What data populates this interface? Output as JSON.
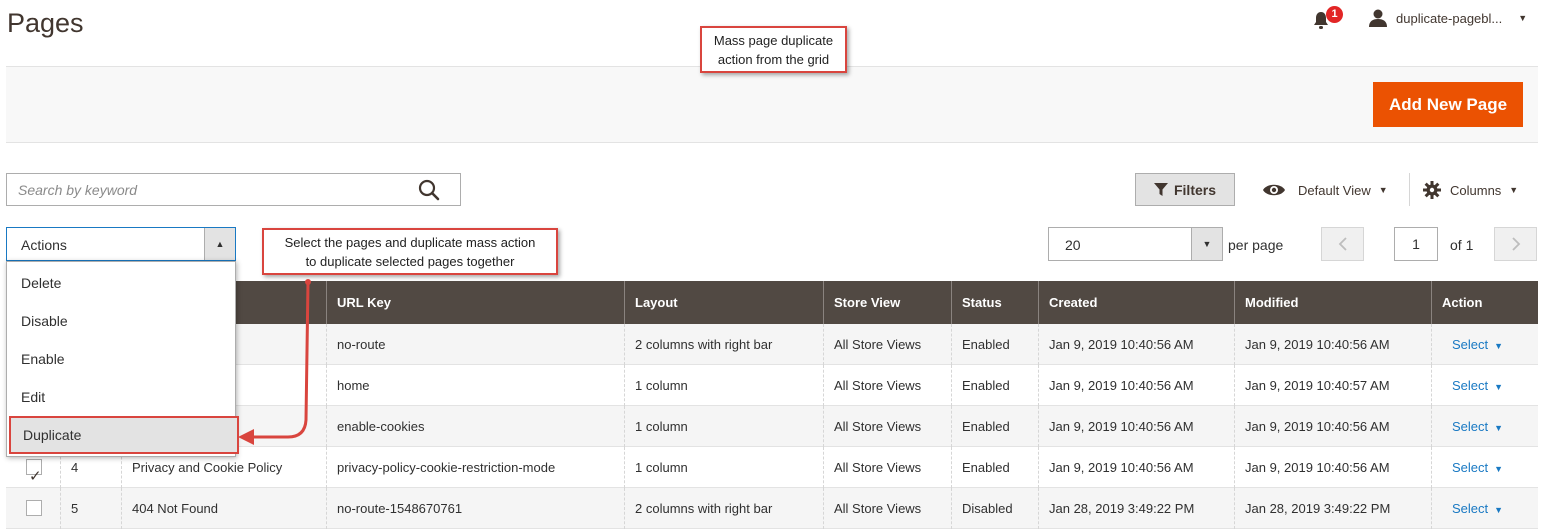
{
  "header": {
    "title": "Pages",
    "notification_count": "1",
    "user_name": "duplicate-pagebl..."
  },
  "annotations": {
    "top": "Mass page duplicate action from the grid",
    "top_line1": "Mass page duplicate",
    "top_line2": "action from the grid",
    "mid_line1": "Select the pages and duplicate mass action",
    "mid_line2": "to duplicate selected pages together"
  },
  "toolbar": {
    "add_new_page": "Add New Page",
    "search_placeholder": "Search by keyword",
    "filters": "Filters",
    "default_view": "Default View",
    "columns": "Columns"
  },
  "actions": {
    "label": "Actions",
    "items": [
      "Delete",
      "Disable",
      "Enable",
      "Edit",
      "Duplicate"
    ]
  },
  "pagination": {
    "per_page_value": "20",
    "per_page_label": "per page",
    "current_page": "1",
    "total": "of 1"
  },
  "grid": {
    "columns": [
      "URL Key",
      "Layout",
      "Store View",
      "Status",
      "Created",
      "Modified",
      "Action"
    ],
    "rows": [
      {
        "checked": false,
        "id": "",
        "title": "",
        "url_key": "no-route",
        "layout": "2 columns with right bar",
        "store_view": "All Store Views",
        "status": "Enabled",
        "created": "Jan 9, 2019 10:40:56 AM",
        "modified": "Jan 9, 2019 10:40:56 AM",
        "action": "Select"
      },
      {
        "checked": false,
        "id": "",
        "title": "",
        "url_key": "home",
        "layout": "1 column",
        "store_view": "All Store Views",
        "status": "Enabled",
        "created": "Jan 9, 2019 10:40:56 AM",
        "modified": "Jan 9, 2019 10:40:57 AM",
        "action": "Select"
      },
      {
        "checked": false,
        "id": "",
        "title": "",
        "url_key": "enable-cookies",
        "layout": "1 column",
        "store_view": "All Store Views",
        "status": "Enabled",
        "created": "Jan 9, 2019 10:40:56 AM",
        "modified": "Jan 9, 2019 10:40:56 AM",
        "action": "Select"
      },
      {
        "checked": true,
        "id": "4",
        "title": "Privacy and Cookie Policy",
        "url_key": "privacy-policy-cookie-restriction-mode",
        "layout": "1 column",
        "store_view": "All Store Views",
        "status": "Enabled",
        "created": "Jan 9, 2019 10:40:56 AM",
        "modified": "Jan 9, 2019 10:40:56 AM",
        "action": "Select"
      },
      {
        "checked": false,
        "id": "5",
        "title": "404 Not Found",
        "url_key": "no-route-1548670761",
        "layout": "2 columns with right bar",
        "store_view": "All Store Views",
        "status": "Disabled",
        "created": "Jan 28, 2019 3:49:22 PM",
        "modified": "Jan 28, 2019 3:49:22 PM",
        "action": "Select"
      }
    ]
  },
  "colors": {
    "accent": "#eb5202",
    "header_bg": "#514943",
    "link": "#1979c3",
    "callout_border": "#d9453e"
  }
}
